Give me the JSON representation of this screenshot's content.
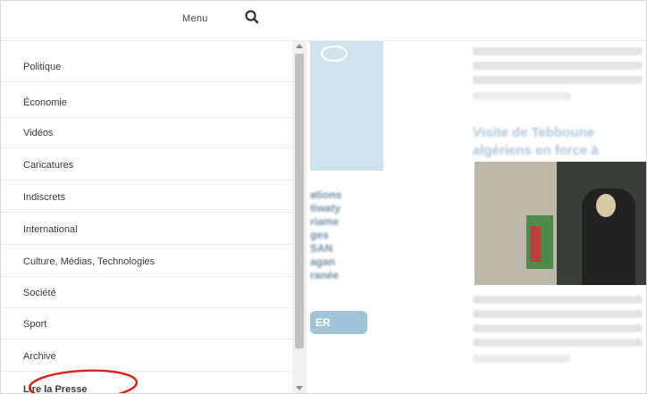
{
  "header": {
    "menu_label": "Menu"
  },
  "menu": {
    "items": [
      {
        "label": "Politique"
      },
      {
        "label": "Économie"
      },
      {
        "label": "Vidéos"
      },
      {
        "label": "Caricatures"
      },
      {
        "label": "Indiscrets"
      },
      {
        "label": "International"
      },
      {
        "label": "Culture, Médias, Technologies"
      },
      {
        "label": "Société"
      },
      {
        "label": "Sport"
      },
      {
        "label": "Archive"
      },
      {
        "label": "Lire la Presse"
      }
    ]
  },
  "background": {
    "ad_button_label": "ER",
    "ad_lines": [
      "ations",
      "tiwaty",
      "riame",
      "ges",
      "SAN",
      "agan",
      "ranée"
    ],
    "article_title_line1": "Visite de Tebboune",
    "article_title_line2": "algériens en force à"
  },
  "colors": {
    "highlight": "#e0201b",
    "scroll_thumb": "#c1c1c1",
    "ad_bg": "#cfe3ef"
  },
  "icons": {
    "search": "search-icon"
  }
}
